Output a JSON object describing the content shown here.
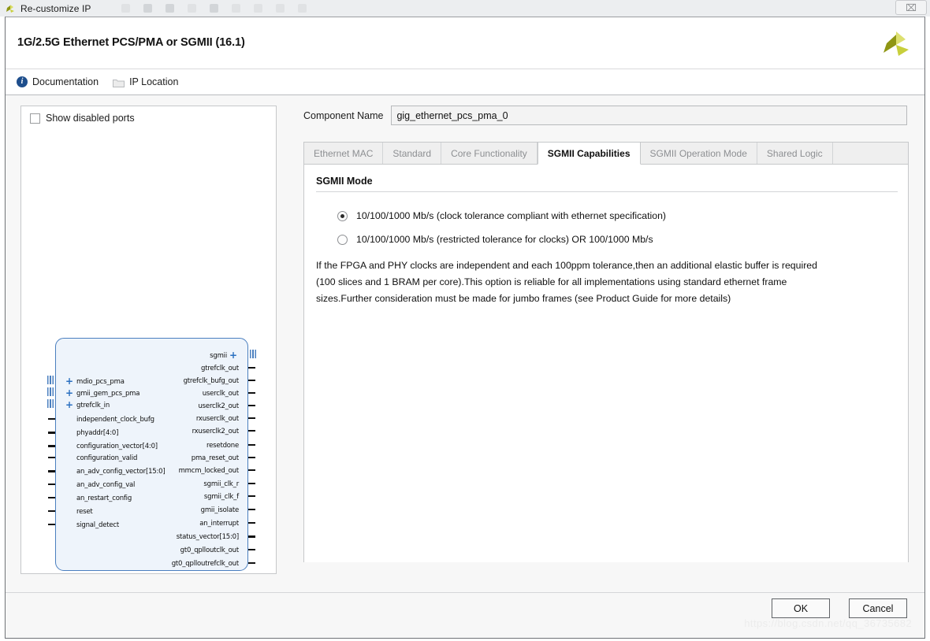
{
  "window": {
    "title": "Re-customize IP",
    "app_icon": "xilinx-logo-icon",
    "close_label": "⌧"
  },
  "header": {
    "title": "1G/2.5G Ethernet PCS/PMA or SGMII (16.1)",
    "logo": "xilinx-logo"
  },
  "links": [
    {
      "icon": "info-icon",
      "label": "Documentation"
    },
    {
      "icon": "folder-icon",
      "label": "IP Location"
    }
  ],
  "left_panel": {
    "show_disabled_ports": {
      "label": "Show disabled ports",
      "checked": false
    },
    "diagram": {
      "left_ports": [
        {
          "name": "mdio_pcs_pma",
          "type": "bus",
          "expandable": true
        },
        {
          "name": "gmii_gem_pcs_pma",
          "type": "bus",
          "expandable": true
        },
        {
          "name": "gtrefclk_in",
          "type": "bus",
          "expandable": true
        },
        {
          "name": "independent_clock_bufg",
          "type": "single",
          "expandable": false
        },
        {
          "name": "phyaddr[4:0]",
          "type": "vector",
          "expandable": false
        },
        {
          "name": "configuration_vector[4:0]",
          "type": "vector",
          "expandable": false
        },
        {
          "name": "configuration_valid",
          "type": "single",
          "expandable": false
        },
        {
          "name": "an_adv_config_vector[15:0]",
          "type": "vector",
          "expandable": false
        },
        {
          "name": "an_adv_config_val",
          "type": "single",
          "expandable": false
        },
        {
          "name": "an_restart_config",
          "type": "single",
          "expandable": false
        },
        {
          "name": "reset",
          "type": "single",
          "expandable": false
        },
        {
          "name": "signal_detect",
          "type": "single",
          "expandable": false
        }
      ],
      "right_ports": [
        {
          "name": "sgmii",
          "type": "bus",
          "expandable": true
        },
        {
          "name": "gtrefclk_out",
          "type": "single",
          "expandable": false
        },
        {
          "name": "gtrefclk_bufg_out",
          "type": "single",
          "expandable": false
        },
        {
          "name": "userclk_out",
          "type": "single",
          "expandable": false
        },
        {
          "name": "userclk2_out",
          "type": "single",
          "expandable": false
        },
        {
          "name": "rxuserclk_out",
          "type": "single",
          "expandable": false
        },
        {
          "name": "rxuserclk2_out",
          "type": "single",
          "expandable": false
        },
        {
          "name": "resetdone",
          "type": "single",
          "expandable": false
        },
        {
          "name": "pma_reset_out",
          "type": "single",
          "expandable": false
        },
        {
          "name": "mmcm_locked_out",
          "type": "single",
          "expandable": false
        },
        {
          "name": "sgmii_clk_r",
          "type": "single",
          "expandable": false
        },
        {
          "name": "sgmii_clk_f",
          "type": "single",
          "expandable": false
        },
        {
          "name": "gmii_isolate",
          "type": "single",
          "expandable": false
        },
        {
          "name": "an_interrupt",
          "type": "single",
          "expandable": false
        },
        {
          "name": "status_vector[15:0]",
          "type": "vector",
          "expandable": false
        },
        {
          "name": "gt0_qplloutclk_out",
          "type": "single",
          "expandable": false
        },
        {
          "name": "gt0_qplloutrefclk_out",
          "type": "single",
          "expandable": false
        }
      ]
    }
  },
  "main": {
    "component_name": {
      "label": "Component Name",
      "value": "gig_ethernet_pcs_pma_0"
    },
    "tabs": [
      {
        "label": "Ethernet MAC",
        "active": false
      },
      {
        "label": "Standard",
        "active": false
      },
      {
        "label": "Core Functionality",
        "active": false
      },
      {
        "label": "SGMII Capabilities",
        "active": true
      },
      {
        "label": "SGMII Operation Mode",
        "active": false
      },
      {
        "label": "Shared Logic",
        "active": false
      }
    ],
    "group_title": "SGMII Mode",
    "radio_options": [
      {
        "label": "10/100/1000 Mb/s (clock tolerance compliant with ethernet specification)",
        "selected": true
      },
      {
        "label": "10/100/1000 Mb/s (restricted tolerance for clocks) OR 100/1000 Mb/s",
        "selected": false
      }
    ],
    "note": "If the FPGA and PHY clocks are independent and each 100ppm tolerance,then an additional elastic buffer is required (100 slices and 1 BRAM per core).This option is reliable for all implementations using standard ethernet frame sizes.Further consideration must be made for jumbo frames (see Product Guide for more details)"
  },
  "footer": {
    "ok_label": "OK",
    "cancel_label": "Cancel",
    "watermark": "https://blog.csdn.net/qq_36735682"
  },
  "colors": {
    "accent_blue": "#2a6fc0",
    "block_fill": "#eef4fb",
    "block_border": "#4a7fbf",
    "logo_green": "#c8cf3c"
  }
}
